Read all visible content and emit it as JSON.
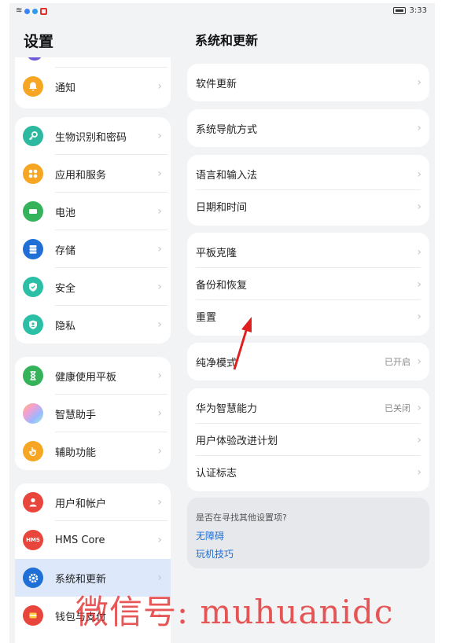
{
  "status_bar": {
    "time": "3:33"
  },
  "left": {
    "title": "设置",
    "groups": [
      {
        "items": [
          {
            "label": "通知",
            "icon": "bell-icon",
            "color": "#f6a623"
          }
        ]
      },
      {
        "items": [
          {
            "label": "生物识别和密码",
            "icon": "key-icon",
            "color": "#2db8a0"
          },
          {
            "label": "应用和服务",
            "icon": "apps-icon",
            "color": "#f6a623"
          },
          {
            "label": "电池",
            "icon": "battery-icon",
            "color": "#34b35a"
          },
          {
            "label": "存储",
            "icon": "storage-icon",
            "color": "#1f6fd6"
          },
          {
            "label": "安全",
            "icon": "shield-icon",
            "color": "#2bbfa6"
          },
          {
            "label": "隐私",
            "icon": "privacy-icon",
            "color": "#2bbfa6"
          }
        ]
      },
      {
        "items": [
          {
            "label": "健康使用平板",
            "icon": "hourglass-icon",
            "color": "#34b35a"
          },
          {
            "label": "智慧助手",
            "icon": "assistant-icon",
            "color": "#c7a0f0"
          },
          {
            "label": "辅助功能",
            "icon": "hand-icon",
            "color": "#f6a623"
          }
        ]
      },
      {
        "items": [
          {
            "label": "用户和帐户",
            "icon": "user-icon",
            "color": "#e8453c"
          },
          {
            "label": "HMS Core",
            "icon": "hms-icon",
            "color": "#e8453c",
            "icon_text": "HMS"
          },
          {
            "label": "系统和更新",
            "icon": "gear-icon",
            "color": "#1f6fd6",
            "selected": true
          },
          {
            "label": "钱包与支付",
            "icon": "wallet-icon",
            "color": "#e8453c"
          }
        ]
      }
    ]
  },
  "right": {
    "title": "系统和更新",
    "groups": [
      {
        "items": [
          {
            "label": "软件更新"
          }
        ]
      },
      {
        "items": [
          {
            "label": "系统导航方式"
          }
        ]
      },
      {
        "items": [
          {
            "label": "语言和输入法"
          },
          {
            "label": "日期和时间"
          }
        ]
      },
      {
        "items": [
          {
            "label": "平板克隆"
          },
          {
            "label": "备份和恢复"
          },
          {
            "label": "重置"
          }
        ]
      },
      {
        "items": [
          {
            "label": "纯净模式",
            "value": "已开启"
          }
        ]
      },
      {
        "items": [
          {
            "label": "华为智慧能力",
            "value": "已关闭"
          },
          {
            "label": "用户体验改进计划"
          },
          {
            "label": "认证标志"
          }
        ]
      }
    ],
    "hint": {
      "question": "是否在寻找其他设置项?",
      "links": [
        "无障碍",
        "玩机技巧"
      ]
    }
  },
  "watermark": "微信号: muhuanidc",
  "annotation_color": "#e02020"
}
